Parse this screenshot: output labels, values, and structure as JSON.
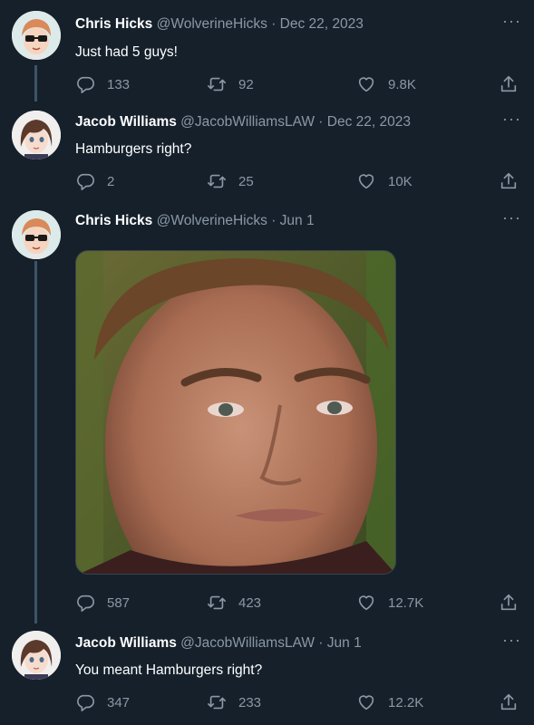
{
  "more_glyph": "···",
  "tweets": [
    {
      "name": "Chris Hicks",
      "handle": "@WolverineHicks",
      "separator": "·",
      "date": "Dec 22, 2023",
      "text": "Just had 5 guys!",
      "replies": "133",
      "retweets": "92",
      "likes": "9.8K"
    },
    {
      "name": "Jacob Williams",
      "handle": "@JacobWilliamsLAW",
      "separator": "·",
      "date": "Dec 22, 2023",
      "text": "Hamburgers right?",
      "replies": "2",
      "retweets": "25",
      "likes": "10K"
    },
    {
      "name": "Chris Hicks",
      "handle": "@WolverineHicks",
      "separator": "·",
      "date": "Jun 1",
      "text": "",
      "replies": "587",
      "retweets": "423",
      "likes": "12.7K"
    },
    {
      "name": "Jacob Williams",
      "handle": "@JacobWilliamsLAW",
      "separator": "·",
      "date": "Jun 1",
      "text": "You meant Hamburgers right?",
      "replies": "347",
      "retweets": "233",
      "likes": "12.2K"
    }
  ],
  "colors": {
    "background": "#15202b",
    "secondary_text": "#8b98a5",
    "thread_line": "#3d5466"
  }
}
